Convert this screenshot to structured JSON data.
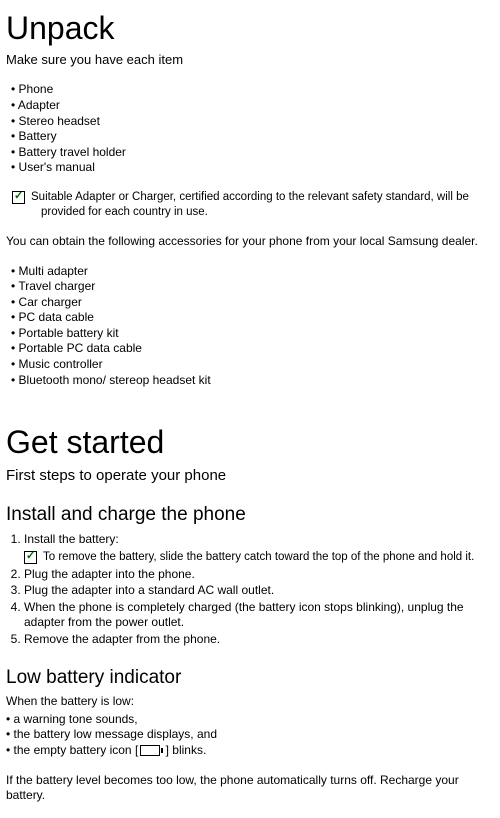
{
  "unpack": {
    "heading": "Unpack",
    "subtitle": "Make sure you have each item",
    "items": [
      "Phone",
      "Adapter",
      "Stereo headset",
      "Battery",
      "Battery travel holder",
      "User's manual"
    ],
    "note": "Suitable Adapter or Charger, certified according to the relevant safety standard, will be provided for each country in use.",
    "accessories_intro": "You can obtain the following accessories for your phone from your local Samsung dealer.",
    "accessories": [
      "Multi adapter",
      "Travel charger",
      "Car charger",
      "PC data cable",
      "Portable battery kit",
      "Portable PC data cable",
      "Music controller",
      "Bluetooth mono/ stereop headset kit"
    ]
  },
  "get_started": {
    "heading": "Get started",
    "subtitle": "First steps to operate your phone",
    "install": {
      "heading": "Install and charge the phone",
      "steps": [
        "Install the battery:",
        "Plug the adapter into the phone.",
        "Plug the adapter into a standard AC wall outlet.",
        "When the phone is completely charged (the battery icon stops blinking), unplug the adapter from the power outlet.",
        "Remove the adapter from the phone."
      ],
      "step1_note": "To remove the battery, slide the battery catch toward the top of the phone and hold it."
    },
    "low_battery": {
      "heading": "Low battery indicator",
      "intro": "When the battery is low:",
      "bullets": {
        "b1": "a warning tone sounds,",
        "b2": "the battery low message displays, and",
        "b3_prefix": "the empty battery icon [",
        "b3_suffix": " ] blinks."
      },
      "outro": "If the battery level becomes too low, the phone automatically turns off.    Recharge your battery."
    }
  }
}
